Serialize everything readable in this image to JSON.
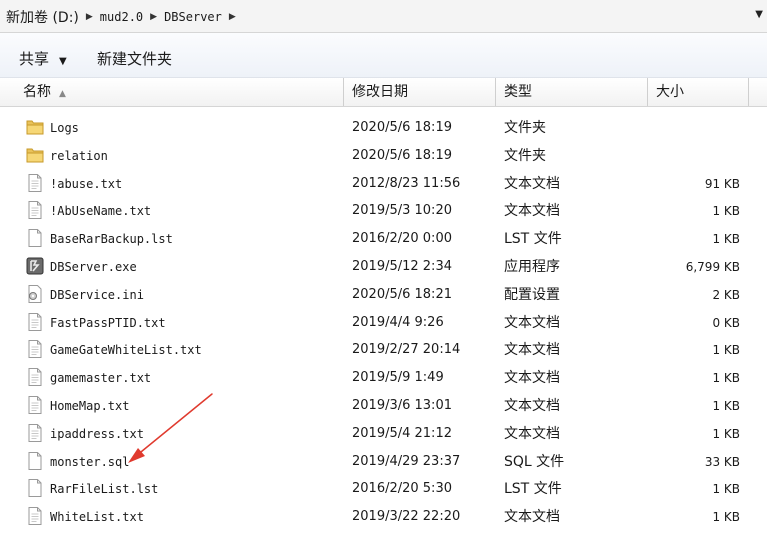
{
  "address_bar": {
    "crumbs": [
      "新加卷 (D:)",
      "mud2.0",
      "DBServer"
    ]
  },
  "toolbar": {
    "share_label": "共享",
    "new_folder_label": "新建文件夹"
  },
  "columns": {
    "name": "名称",
    "date": "修改日期",
    "type": "类型",
    "size": "大小"
  },
  "files": [
    {
      "name": "Logs",
      "date": "2020/5/6 18:19",
      "type": "文件夹",
      "size": "",
      "icon": "folder-icon"
    },
    {
      "name": "relation",
      "date": "2020/5/6 18:19",
      "type": "文件夹",
      "size": "",
      "icon": "folder-icon"
    },
    {
      "name": "!abuse.txt",
      "date": "2012/8/23 11:56",
      "type": "文本文档",
      "size": "91 KB",
      "icon": "text-file-icon"
    },
    {
      "name": "!AbUseName.txt",
      "date": "2019/5/3 10:20",
      "type": "文本文档",
      "size": "1 KB",
      "icon": "text-file-icon"
    },
    {
      "name": "BaseRarBackup.lst",
      "date": "2016/2/20 0:00",
      "type": "LST 文件",
      "size": "1 KB",
      "icon": "file-icon"
    },
    {
      "name": "DBServer.exe",
      "date": "2019/5/12 2:34",
      "type": "应用程序",
      "size": "6,799 KB",
      "icon": "application-icon"
    },
    {
      "name": "DBService.ini",
      "date": "2020/5/6 18:21",
      "type": "配置设置",
      "size": "2 KB",
      "icon": "settings-file-icon"
    },
    {
      "name": "FastPassPTID.txt",
      "date": "2019/4/4 9:26",
      "type": "文本文档",
      "size": "0 KB",
      "icon": "text-file-icon"
    },
    {
      "name": "GameGateWhiteList.txt",
      "date": "2019/2/27 20:14",
      "type": "文本文档",
      "size": "1 KB",
      "icon": "text-file-icon"
    },
    {
      "name": "gamemaster.txt",
      "date": "2019/5/9 1:49",
      "type": "文本文档",
      "size": "1 KB",
      "icon": "text-file-icon"
    },
    {
      "name": "HomeMap.txt",
      "date": "2019/3/6 13:01",
      "type": "文本文档",
      "size": "1 KB",
      "icon": "text-file-icon"
    },
    {
      "name": "ipaddress.txt",
      "date": "2019/5/4 21:12",
      "type": "文本文档",
      "size": "1 KB",
      "icon": "text-file-icon"
    },
    {
      "name": "monster.sql",
      "date": "2019/4/29 23:37",
      "type": "SQL 文件",
      "size": "33 KB",
      "icon": "file-icon"
    },
    {
      "name": "RarFileList.lst",
      "date": "2016/2/20 5:30",
      "type": "LST 文件",
      "size": "1 KB",
      "icon": "file-icon"
    },
    {
      "name": "WhiteList.txt",
      "date": "2019/3/22 22:20",
      "type": "文本文档",
      "size": "1 KB",
      "icon": "text-file-icon"
    }
  ],
  "annotation": {
    "color": "#e03a2e"
  }
}
